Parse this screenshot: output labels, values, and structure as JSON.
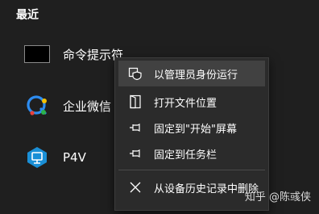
{
  "section": {
    "title": "最近"
  },
  "apps": [
    {
      "label": "命令提示符",
      "icon": "command-prompt-icon"
    },
    {
      "label": "企业微信",
      "icon": "wecom-icon"
    },
    {
      "label": "P4V",
      "icon": "p4v-icon"
    }
  ],
  "context_menu": {
    "items": [
      {
        "label": "以管理员身份运行",
        "icon": "run-as-admin-icon",
        "highlighted": true
      },
      {
        "label": "打开文件位置",
        "icon": "open-file-location-icon"
      },
      {
        "label": "固定到\"开始\"屏幕",
        "icon": "pin-icon"
      },
      {
        "label": "固定到任务栏",
        "icon": "pin-icon"
      },
      {
        "label": "从设备历史记录中删除",
        "icon": "close-icon"
      }
    ]
  },
  "watermark": {
    "text": "知乎 @陈彧侠"
  },
  "colors": {
    "background": "#1f1f1f",
    "menu_background": "#2b2b2b",
    "menu_highlight": "#414141",
    "wecom_blue": "#2d8cf0",
    "p4v_blue": "#1a8fd6"
  }
}
